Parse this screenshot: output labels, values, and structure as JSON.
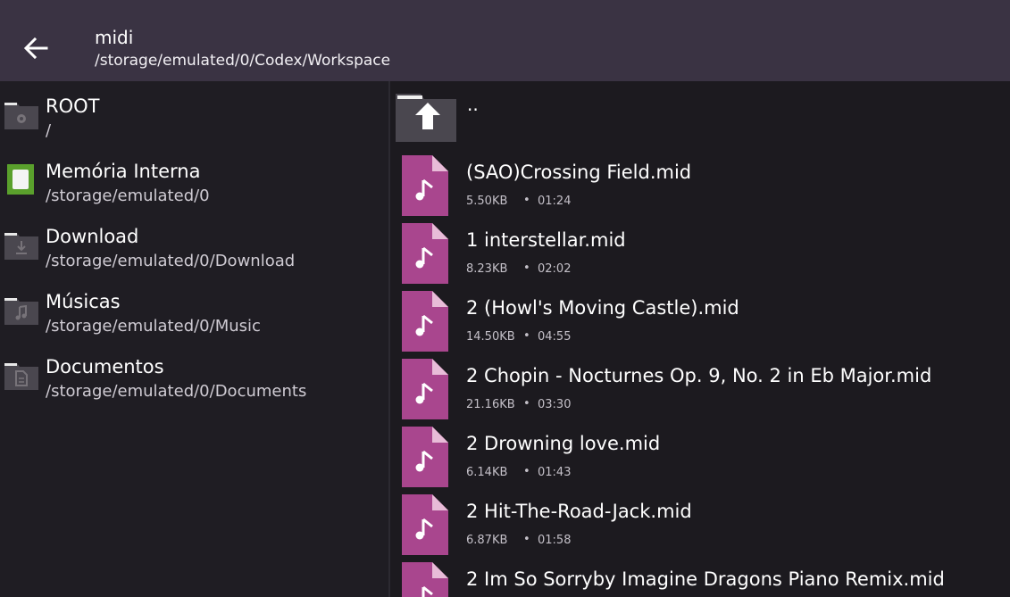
{
  "header": {
    "title": "midi",
    "path": "/storage/emulated/0/Codex/Workspace"
  },
  "sidebar": {
    "items": [
      {
        "name": "ROOT",
        "path": "/",
        "icon": "root-folder-icon"
      },
      {
        "name": "Memória Interna",
        "path": "/storage/emulated/0",
        "icon": "internal-storage-icon"
      },
      {
        "name": "Download",
        "path": "/storage/emulated/0/Download",
        "icon": "download-folder-icon"
      },
      {
        "name": "Músicas",
        "path": "/storage/emulated/0/Music",
        "icon": "music-folder-icon"
      },
      {
        "name": "Documentos",
        "path": "/storage/emulated/0/Documents",
        "icon": "documents-folder-icon"
      }
    ]
  },
  "files": {
    "parent_label": "..",
    "items": [
      {
        "name": "(SAO)Crossing Field.mid",
        "size": "5.50KB",
        "duration": "01:24"
      },
      {
        "name": "1 interstellar.mid",
        "size": "8.23KB",
        "duration": "02:02"
      },
      {
        "name": "2 (Howl's Moving Castle).mid",
        "size": "14.50KB",
        "duration": "04:55"
      },
      {
        "name": "2 Chopin - Nocturnes Op. 9, No. 2 in Eb Major.mid",
        "size": "21.16KB",
        "duration": "03:30"
      },
      {
        "name": "2 Drowning love.mid",
        "size": "6.14KB",
        "duration": "01:43"
      },
      {
        "name": "2 Hit-The-Road-Jack.mid",
        "size": "6.87KB",
        "duration": "01:58"
      },
      {
        "name": "2 Im So Sorryby Imagine Dragons Piano Remix.mid",
        "size": "",
        "duration": ""
      }
    ]
  },
  "colors": {
    "topbar": "#3a3343",
    "midi_icon": "#a9468e",
    "storage_green": "#5aa02c"
  }
}
